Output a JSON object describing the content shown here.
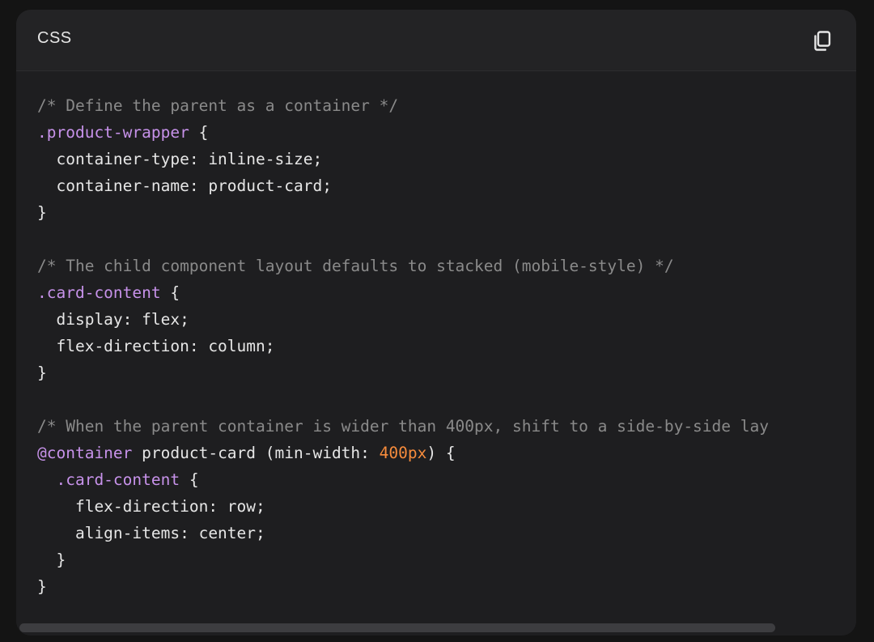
{
  "header": {
    "language": "CSS",
    "copy_icon": "copy-icon"
  },
  "code": {
    "lines": [
      [
        {
          "t": "/* Define the parent as a container */",
          "k": "comment"
        }
      ],
      [
        {
          "t": ".product-wrapper",
          "k": "selector"
        },
        {
          "t": " {",
          "k": "plain"
        }
      ],
      [
        {
          "t": "  container-type: inline-size;",
          "k": "plain"
        }
      ],
      [
        {
          "t": "  container-name: product-card;",
          "k": "plain"
        }
      ],
      [
        {
          "t": "}",
          "k": "plain"
        }
      ],
      [
        {
          "t": "",
          "k": "plain"
        }
      ],
      [
        {
          "t": "/* The child component layout defaults to stacked (mobile-style) */",
          "k": "comment"
        }
      ],
      [
        {
          "t": ".card-content",
          "k": "selector"
        },
        {
          "t": " {",
          "k": "plain"
        }
      ],
      [
        {
          "t": "  display: flex;",
          "k": "plain"
        }
      ],
      [
        {
          "t": "  flex-direction: column;",
          "k": "plain"
        }
      ],
      [
        {
          "t": "}",
          "k": "plain"
        }
      ],
      [
        {
          "t": "",
          "k": "plain"
        }
      ],
      [
        {
          "t": "/* When the parent container is wider than 400px, shift to a side-by-side lay",
          "k": "comment"
        }
      ],
      [
        {
          "t": "@container",
          "k": "keyword"
        },
        {
          "t": " product-card (min-width: ",
          "k": "plain"
        },
        {
          "t": "400px",
          "k": "number"
        },
        {
          "t": ") {",
          "k": "plain"
        }
      ],
      [
        {
          "t": "  ",
          "k": "plain"
        },
        {
          "t": ".card-content",
          "k": "selector"
        },
        {
          "t": " {",
          "k": "plain"
        }
      ],
      [
        {
          "t": "    flex-direction: row;",
          "k": "plain"
        }
      ],
      [
        {
          "t": "    align-items: center;",
          "k": "plain"
        }
      ],
      [
        {
          "t": "  }",
          "k": "plain"
        }
      ],
      [
        {
          "t": "}",
          "k": "plain"
        }
      ]
    ]
  },
  "colors": {
    "background": "#1e1e20",
    "header": "#232325",
    "comment": "#8a8a8a",
    "selector": "#c792ea",
    "number": "#f78c3c",
    "text": "#e6e6e6"
  }
}
